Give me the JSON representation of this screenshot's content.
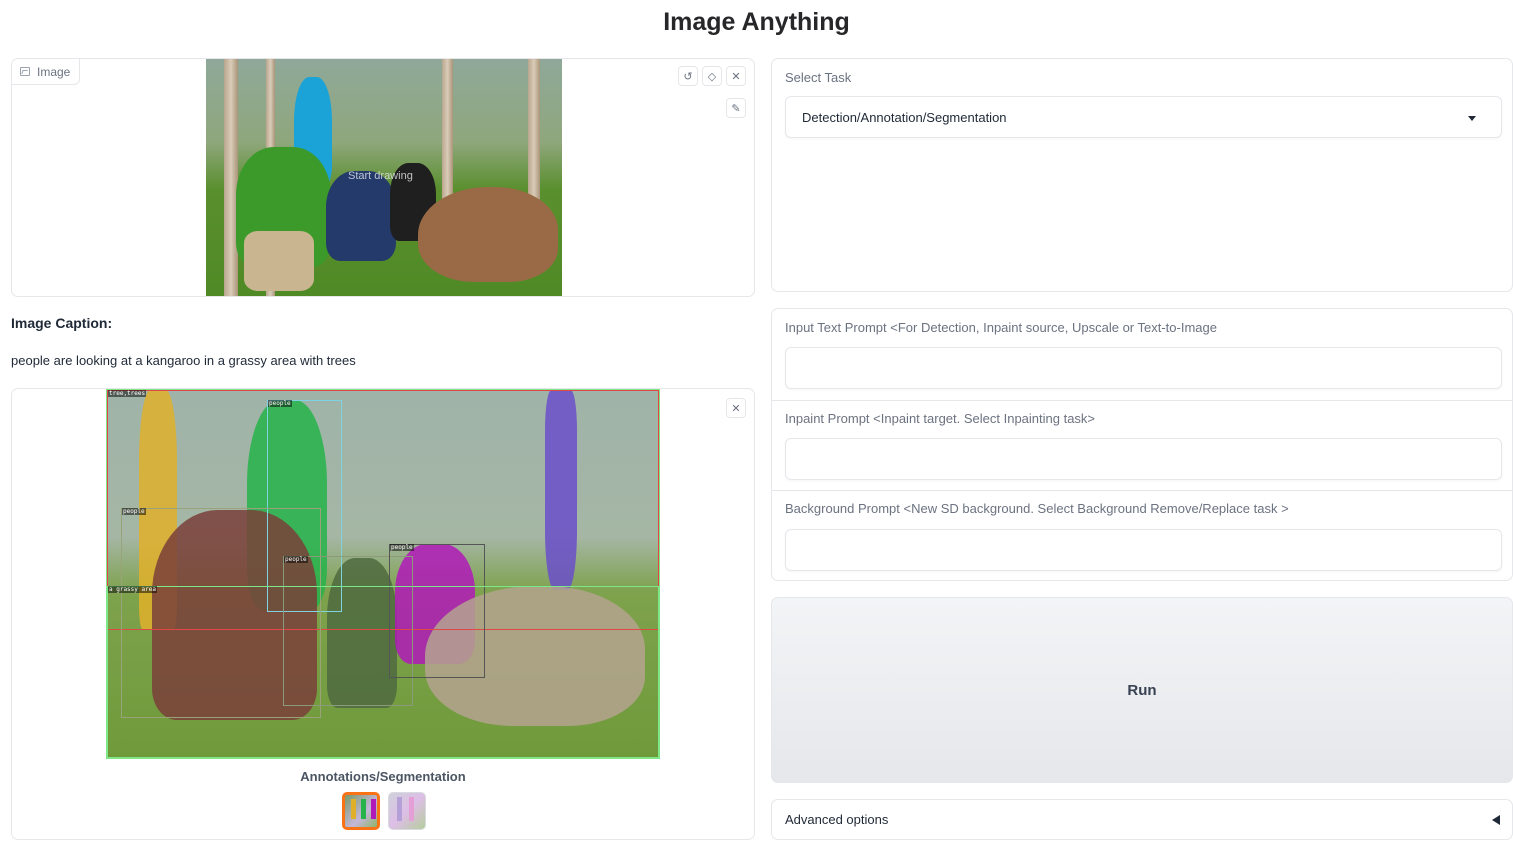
{
  "app": {
    "title": "Image Anything"
  },
  "input_image": {
    "label": "Image",
    "hint": "Start drawing",
    "tools": {
      "undo_icon": "undo-icon",
      "erase_icon": "eraser-icon",
      "clear_icon": "close-icon",
      "brush_icon": "brush-icon"
    }
  },
  "caption": {
    "title": "Image Caption:",
    "text": "people are looking at a kangaroo in a grassy area with trees"
  },
  "gallery": {
    "caption": "Annotations/Segmentation",
    "labels": {
      "tree1": "tree,trees",
      "people1": "people",
      "people2": "people",
      "people3": "people",
      "people4": "people",
      "grass": "a grassy area"
    }
  },
  "task": {
    "label": "Select Task",
    "selected": "Detection/Annotation/Segmentation"
  },
  "prompts": {
    "text_prompt_label": "Input Text Prompt <For Detection, Inpaint source, Upscale or Text-to-Image",
    "inpaint_prompt_label": "Inpaint Prompt <Inpaint target. Select Inpainting task>",
    "background_prompt_label": "Background Prompt <New SD background. Select Background Remove/Replace task >"
  },
  "run": {
    "label": "Run"
  },
  "advanced": {
    "label": "Advanced options"
  }
}
